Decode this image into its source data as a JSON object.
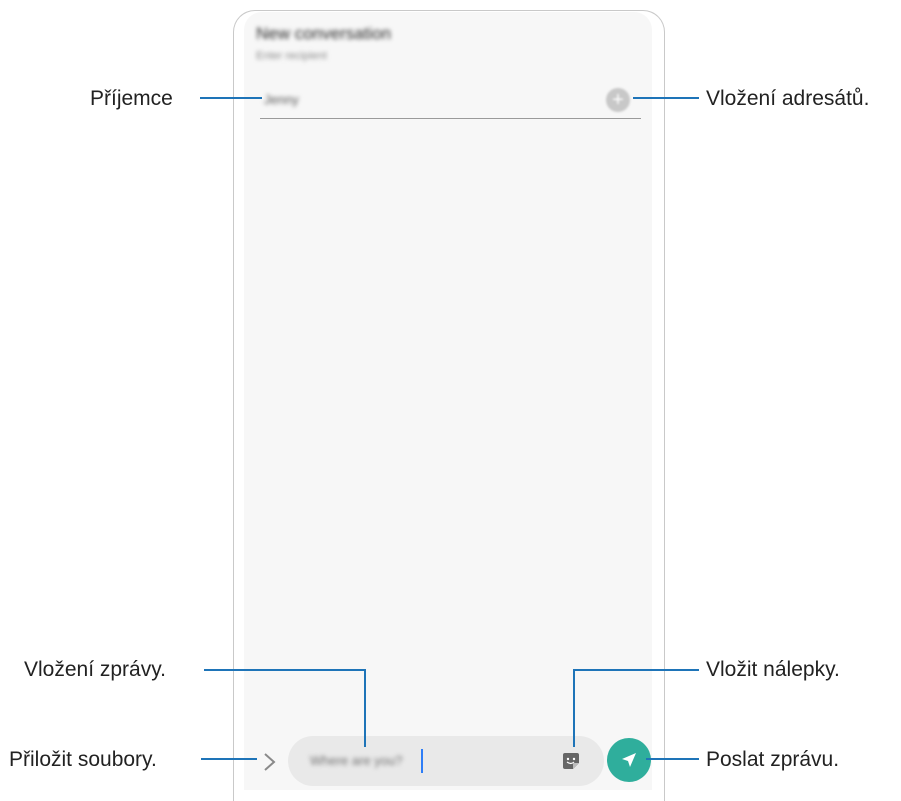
{
  "screen": {
    "title": "New conversation",
    "subtitle": "Enter recipient",
    "recipient_value": "Jenny",
    "add_recipient_icon": "plus-circle-icon",
    "message_placeholder": "Where are you?",
    "attach_icon": "chevron-right-icon",
    "sticker_icon": "sticker-icon",
    "send_icon": "send-icon",
    "accent_color": "#2fae9c"
  },
  "callouts": {
    "recipient": "Příjemce",
    "add_recipients": "Vložení adresátů.",
    "enter_message": "Vložení zprávy.",
    "insert_stickers": "Vložit nálepky.",
    "attach_files": "Přiložit soubory.",
    "send_message": "Poslat zprávu."
  }
}
